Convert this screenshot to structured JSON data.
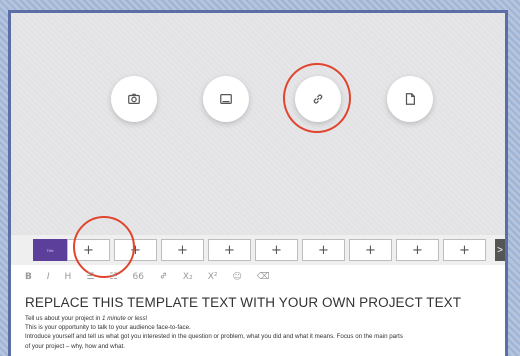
{
  "media_buttons": [
    {
      "icon": "camera-icon",
      "label": ""
    },
    {
      "icon": "image-icon",
      "label": ""
    },
    {
      "icon": "link-icon",
      "label": ""
    },
    {
      "icon": "document-icon",
      "label": ""
    }
  ],
  "thumbnail": {
    "label": "Title"
  },
  "slot_label": "+",
  "scroll_label": ">",
  "toolbar": {
    "bold": "B",
    "italic": "I",
    "heading": "H",
    "bullets": "☰",
    "numbers": "☷",
    "quote": "66",
    "link": "🔗",
    "sub": "X₂",
    "sup": "X²",
    "emoji": "☺",
    "clear": "⌫"
  },
  "editor": {
    "heading": "REPLACE THIS TEMPLATE TEXT WITH YOUR OWN PROJECT TEXT",
    "line1_prefix": "Tell us about your project in ",
    "line1_em": "1 minute or less",
    "line1_suffix": "!",
    "line2": "This is your opportunity to talk to your audience face-to-face.",
    "line3": "Introduce yourself and tell us what got you interested in the question or problem, what you did and what it means. Focus on the main parts",
    "line4": "of your project – why, how and what."
  },
  "colors": {
    "annotation": "#e0452e",
    "frame": "#5b6fa6"
  }
}
